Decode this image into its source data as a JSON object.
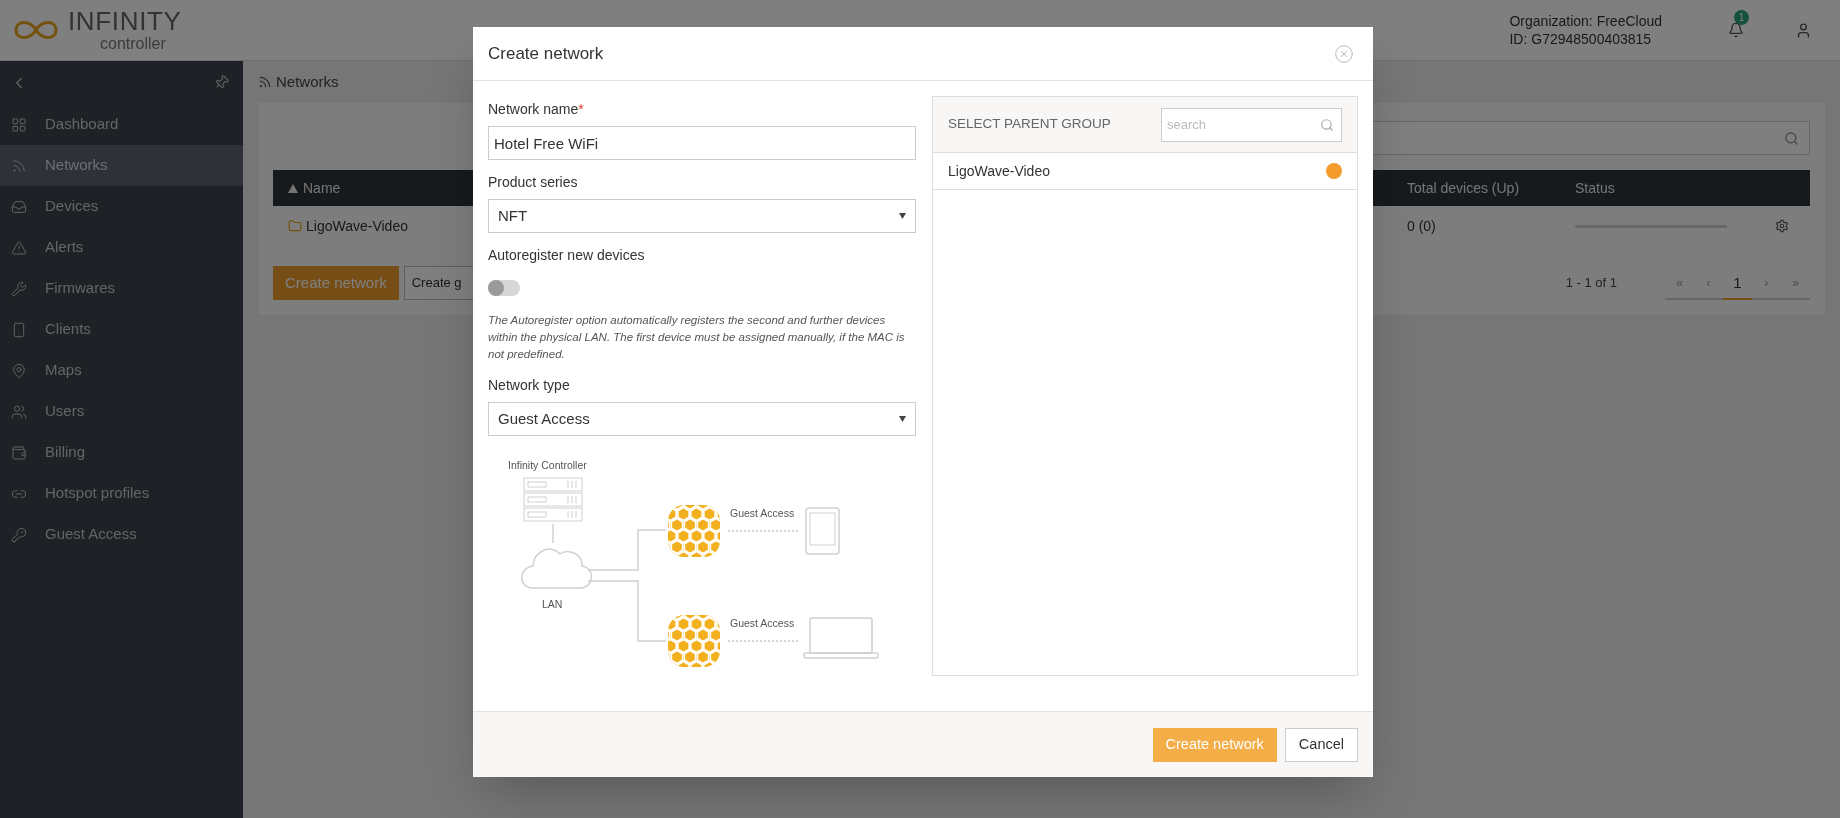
{
  "header": {
    "logo_title": "INFINITY",
    "logo_subtitle": "controller",
    "organization": "Organization: FreeCloud",
    "org_id": "ID: G72948500403815",
    "notification_count": "1"
  },
  "sidebar": {
    "items": [
      {
        "label": "Dashboard",
        "selected": false
      },
      {
        "label": "Networks",
        "selected": true
      },
      {
        "label": "Devices",
        "selected": false
      },
      {
        "label": "Alerts",
        "selected": false
      },
      {
        "label": "Firmwares",
        "selected": false
      },
      {
        "label": "Clients",
        "selected": false
      },
      {
        "label": "Maps",
        "selected": false
      },
      {
        "label": "Users",
        "selected": false
      },
      {
        "label": "Billing",
        "selected": false
      },
      {
        "label": "Hotspot profiles",
        "selected": false
      },
      {
        "label": "Guest Access",
        "selected": false
      }
    ]
  },
  "breadcrumb": "Networks",
  "table": {
    "columns": [
      {
        "label": "Name",
        "sorted": true
      },
      {
        "label": "Total devices (Up)",
        "sorted": false
      },
      {
        "label": "Status",
        "sorted": false
      }
    ],
    "rows": [
      {
        "name": "LigoWave-Video",
        "total_devices": "0 (0)"
      }
    ]
  },
  "buttons": [
    {
      "label": "Create network",
      "kind": "primary"
    },
    {
      "label": "Create g",
      "kind": "secondary"
    }
  ],
  "pagination": {
    "summary": "1 - 1 of 1",
    "pages": [
      {
        "label": "«",
        "selected": false
      },
      {
        "label": "‹",
        "selected": false
      },
      {
        "label": "1",
        "selected": true
      },
      {
        "label": "›",
        "selected": false
      },
      {
        "label": "»",
        "selected": false
      }
    ]
  },
  "dialog": {
    "title": "Create network",
    "network_name": {
      "label": "Network name",
      "required_mark": "*",
      "value": "Hotel Free WiFi"
    },
    "product_series": {
      "label": "Product series",
      "value": "NFT"
    },
    "autoregister": {
      "label": "Autoregister new devices",
      "on": false,
      "help": "The Autoregister option automatically registers the second and further devices within the physical LAN. The first device must be assigned manually, if the MAC is not predefined."
    },
    "network_type": {
      "label": "Network type",
      "value": "Guest Access"
    },
    "diagram": {
      "controller_label": "Infinity Controller",
      "lan_label": "LAN",
      "link_labels": [
        "Guest Access",
        "Guest Access"
      ]
    },
    "parent_group": {
      "title": "SELECT PARENT GROUP",
      "search_placeholder": "search",
      "items": [
        {
          "name": "LigoWave-Video",
          "selected": true
        }
      ]
    },
    "footer_buttons": [
      {
        "label": "Create network",
        "kind": "primary"
      },
      {
        "label": "Cancel",
        "kind": "secondary"
      }
    ]
  }
}
